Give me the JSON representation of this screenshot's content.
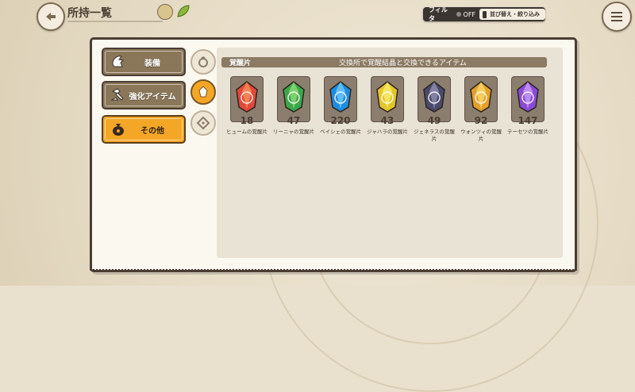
{
  "header": {
    "title": "所持一覧",
    "filter_label": "フィルタ",
    "filter_state": "OFF",
    "sort_label": "並び替え・絞り込み"
  },
  "categories": [
    {
      "label": "装備",
      "icon": "helmet-icon",
      "active": false
    },
    {
      "label": "強化アイテム",
      "icon": "hammer-icon",
      "active": false
    },
    {
      "label": "その他",
      "icon": "bag-icon",
      "active": true
    }
  ],
  "subtabs": [
    {
      "icon": "ring-icon",
      "active": false
    },
    {
      "icon": "crystal-icon",
      "active": true
    },
    {
      "icon": "diamond-icon",
      "active": false
    }
  ],
  "section": {
    "title": "覚醒片",
    "description": "交換所で覚醒結晶と交換できるアイテム"
  },
  "items": [
    {
      "name": "ヒュームの覚醒片",
      "count": "18",
      "color": "#e2483a",
      "light": "#ff9a5e"
    },
    {
      "name": "リーニャの覚醒片",
      "count": "47",
      "color": "#3aa84a",
      "light": "#9de07a"
    },
    {
      "name": "ベイシェの覚醒片",
      "count": "220",
      "color": "#1e8de0",
      "light": "#7fd2ff"
    },
    {
      "name": "ジャハラの覚醒片",
      "count": "43",
      "color": "#e3c62a",
      "light": "#fff27a"
    },
    {
      "name": "ジェネラスの覚醒片",
      "count": "49",
      "color": "#4a4a6a",
      "light": "#9a9ac0"
    },
    {
      "name": "ウォンツィの覚醒片",
      "count": "92",
      "color": "#e3a12a",
      "light": "#ffe07a"
    },
    {
      "name": "テーセツの覚醒片",
      "count": "147",
      "color": "#8a4ad8",
      "light": "#d3a8ff"
    }
  ],
  "colors": {
    "accent": "#f4a626",
    "panel_border": "#4a3d33",
    "tab_inactive": "#8a7659"
  }
}
